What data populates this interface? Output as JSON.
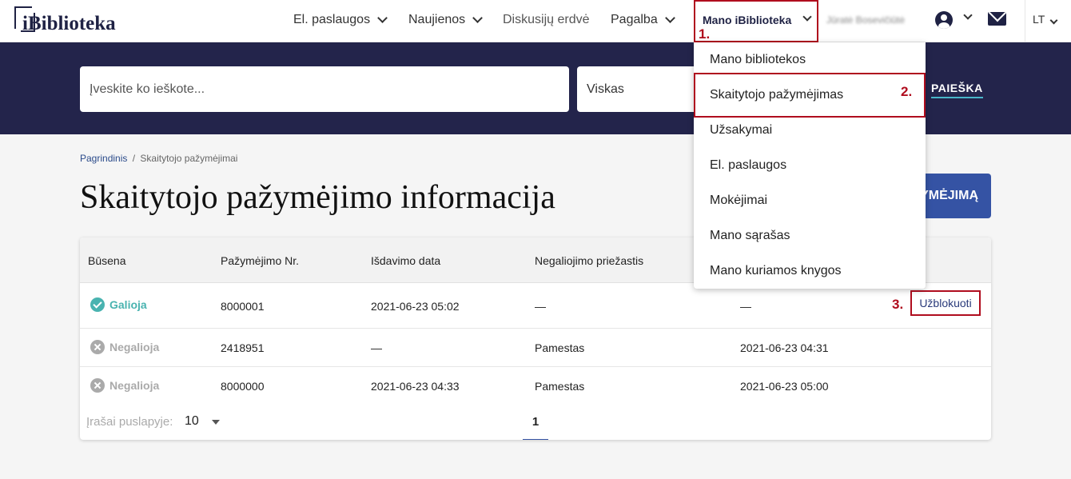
{
  "logo": {
    "text": "iBiblioteka"
  },
  "nav": {
    "items": [
      "El. paslaugos",
      "Naujienos",
      "Diskusijų erdvė",
      "Pagalba"
    ],
    "mano": "Mano iBiblioteka",
    "user_name": "Jūratė Bosevičiūtė",
    "lang": "LT"
  },
  "annotations": {
    "step1": "1.",
    "step2": "2.",
    "step3": "3."
  },
  "search": {
    "placeholder": "Įveskite ko ieškote...",
    "select_value": "Viskas",
    "button": "PAIEŠKA"
  },
  "breadcrumb": {
    "home": "Pagrindinis",
    "separator": "/",
    "current": "Skaitytojo pažymėjimai"
  },
  "page": {
    "title": "Skaitytojo pažymėjimo informacija",
    "primary_button_visible": "YMĖJIMĄ"
  },
  "dropdown": {
    "items": [
      "Mano bibliotekos",
      "Skaitytojo pažymėjimas",
      "Užsakymai",
      "El. paslaugos",
      "Mokėjimai",
      "Mano sąrašas",
      "Mano kuriamos knygos"
    ],
    "active_index": 1
  },
  "table": {
    "headers": [
      "Būsena",
      "Pažymėjimo Nr.",
      "Išdavimo data",
      "Negaliojimo priežastis"
    ],
    "rows": [
      {
        "status": "Galioja",
        "status_type": "valid",
        "number": "8000001",
        "issued": "2021-06-23 05:02",
        "reason": "—",
        "invalid_date": "—",
        "action": "Užblokuoti"
      },
      {
        "status": "Negalioja",
        "status_type": "invalid",
        "number": "2418951",
        "issued": "—",
        "reason": "Pamestas",
        "invalid_date": "2021-06-23 04:31",
        "action": ""
      },
      {
        "status": "Negalioja",
        "status_type": "invalid",
        "number": "8000000",
        "issued": "2021-06-23 04:33",
        "reason": "Pamestas",
        "invalid_date": "2021-06-23 05:00",
        "action": ""
      }
    ],
    "per_page_label": "Įrašai puslapyje:",
    "per_page_value": "10",
    "current_page": "1"
  },
  "colors": {
    "navy": "#23244b",
    "accent_red": "#b00d1e",
    "valid": "#49b3b0",
    "primary": "#3553a4"
  }
}
